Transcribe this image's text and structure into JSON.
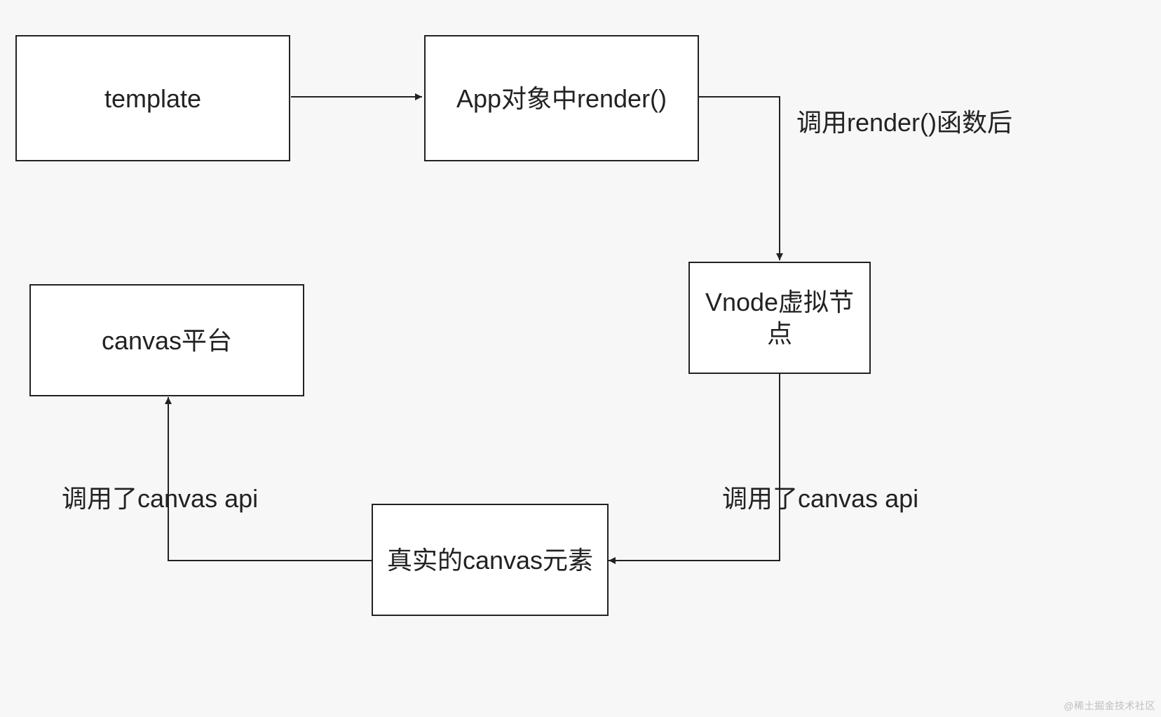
{
  "diagram": {
    "nodes": {
      "template": {
        "text": "template"
      },
      "app_render": {
        "text": "App对象中render()"
      },
      "vnode": {
        "text": "Vnode虚拟节点"
      },
      "canvas_elem": {
        "text": "真实的canvas元素"
      },
      "canvas_plat": {
        "text": "canvas平台"
      }
    },
    "edges": {
      "tpl_to_render": {
        "label": ""
      },
      "render_to_vnode": {
        "label": "调用render()函数后"
      },
      "vnode_to_canvas_elem": {
        "label": "调用了canvas api"
      },
      "canvas_elem_to_plat": {
        "label": "调用了canvas api"
      }
    }
  },
  "watermark": "@稀土掘金技术社区"
}
